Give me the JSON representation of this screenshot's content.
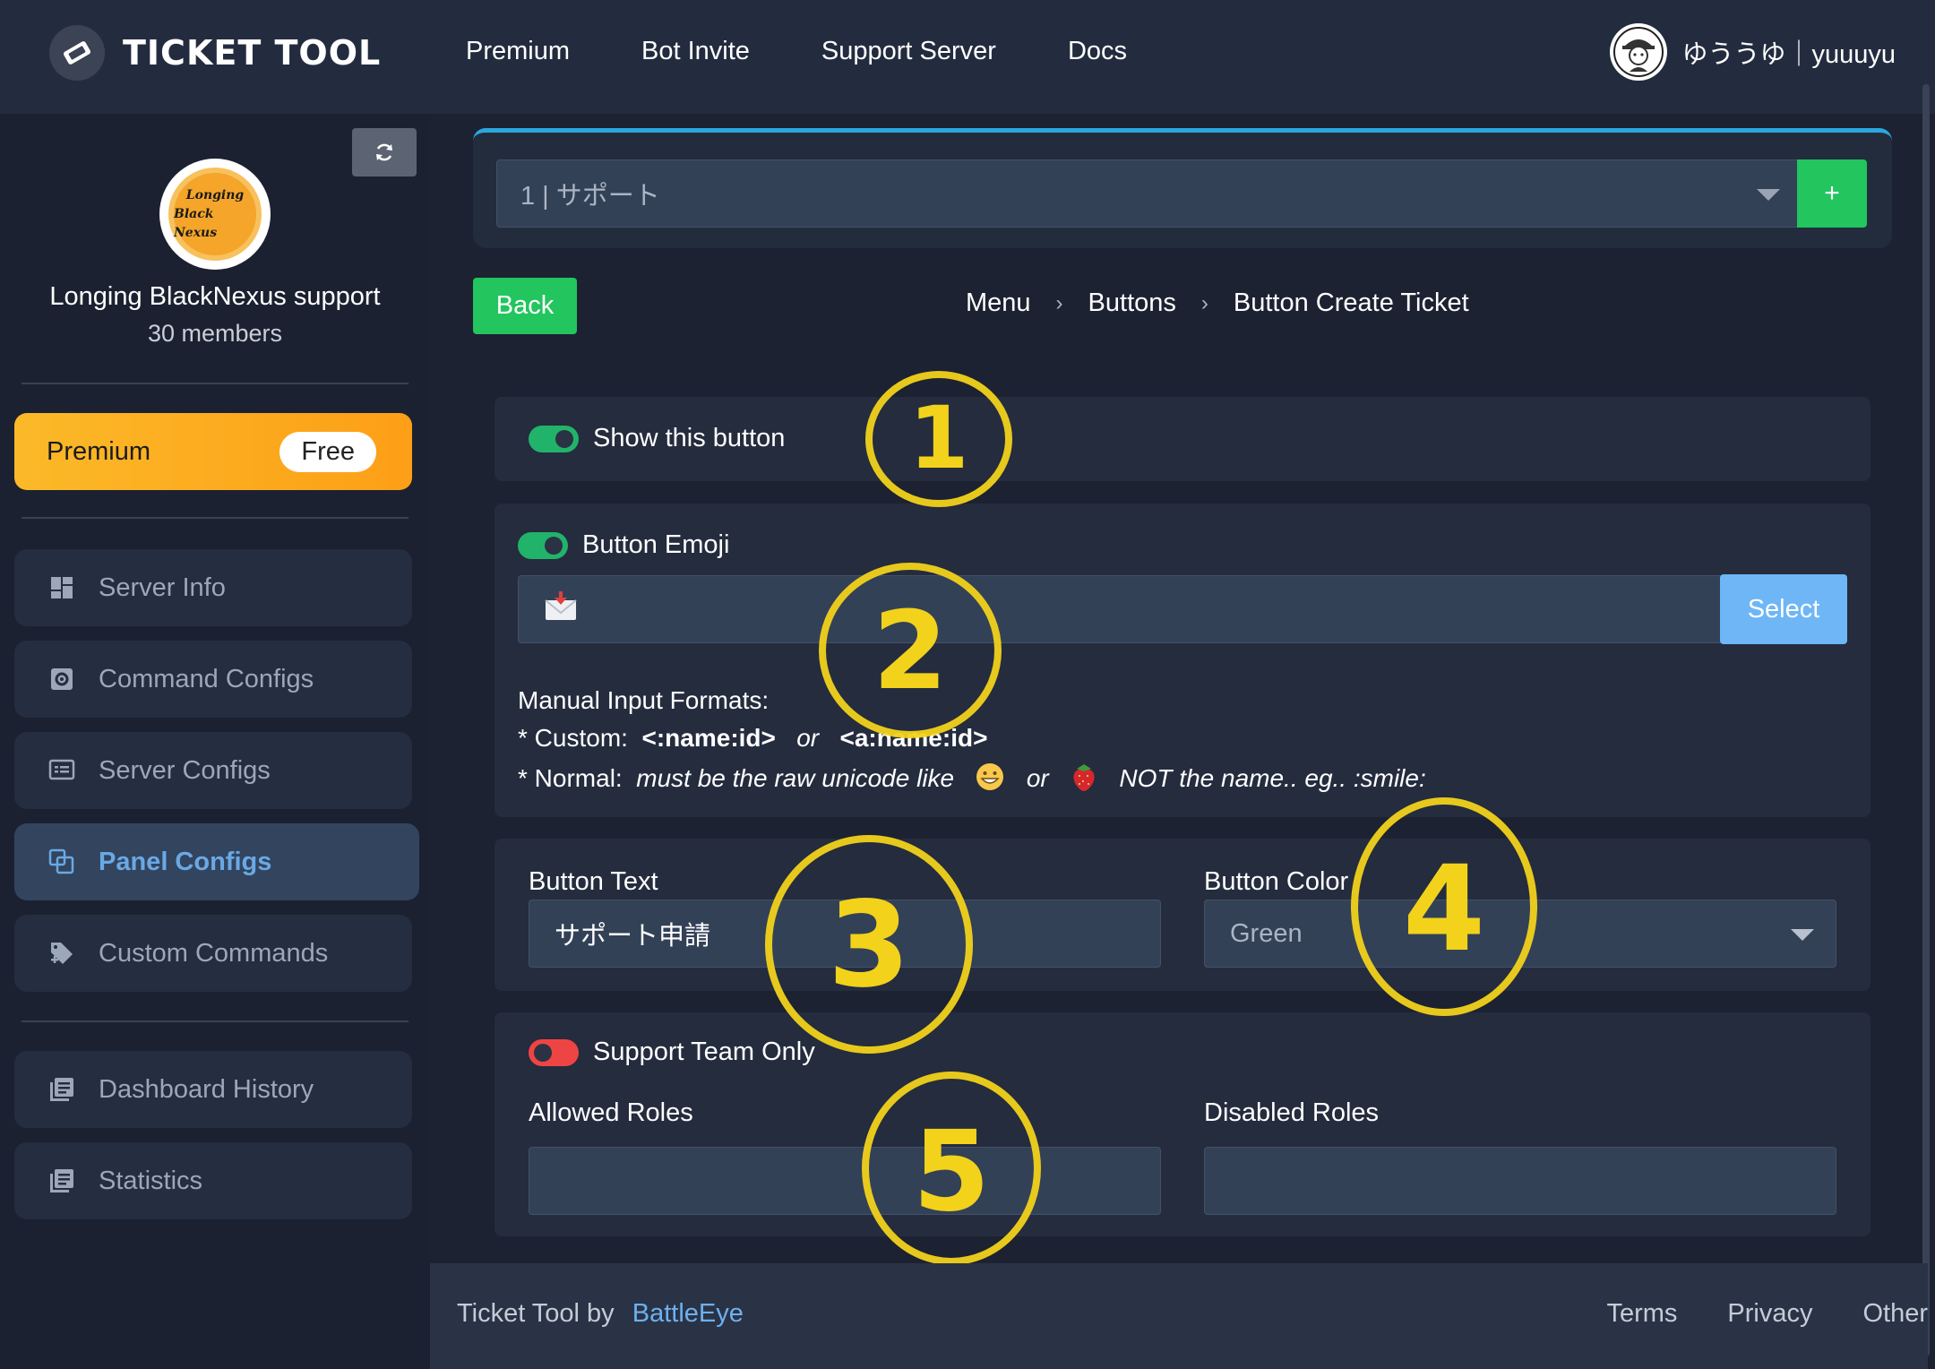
{
  "app": {
    "logo_text": "TICKET TOOL"
  },
  "topnav": {
    "items": [
      "Premium",
      "Bot Invite",
      "Support Server",
      "Docs"
    ]
  },
  "user": {
    "name": "ゆううゆ｜yuuuyu"
  },
  "sidebar": {
    "server_logo_line1": "Longing",
    "server_logo_line2": "Black Nexus",
    "server_name": "Longing BlackNexus support",
    "members": "30 members",
    "premium_label": "Premium",
    "premium_badge": "Free",
    "items": [
      {
        "label": "Server Info",
        "icon": "dashboard-icon"
      },
      {
        "label": "Command Configs",
        "icon": "gear-icon"
      },
      {
        "label": "Server Configs",
        "icon": "server-config-icon"
      },
      {
        "label": "Panel Configs",
        "icon": "panels-icon",
        "active": true
      },
      {
        "label": "Custom Commands",
        "icon": "tag-plus-icon"
      },
      {
        "label": "Dashboard History",
        "icon": "history-icon"
      },
      {
        "label": "Statistics",
        "icon": "statistics-icon"
      }
    ]
  },
  "panel_selector": {
    "value": "1 | サポート",
    "add_label": "+"
  },
  "back_label": "Back",
  "breadcrumb": [
    "Menu",
    "Buttons",
    "Button Create Ticket"
  ],
  "show_button": {
    "label": "Show this button",
    "enabled": true
  },
  "button_emoji": {
    "label": "Button Emoji",
    "enabled": true,
    "value_icon": "incoming-envelope-emoji",
    "select_label": "Select",
    "formats_title": "Manual Input Formats:",
    "custom_prefix": "* Custom:",
    "custom_format_1": "<:name:id>",
    "custom_or": "or",
    "custom_format_2": "<a:name:id>",
    "normal_prefix": "* Normal:",
    "normal_text": "must be the raw unicode like",
    "normal_or": "or",
    "normal_suffix": "NOT the name.. eg.. :smile:"
  },
  "button_text": {
    "label": "Button Text",
    "value": "サポート申請"
  },
  "button_color": {
    "label": "Button Color",
    "value": "Green"
  },
  "support_team": {
    "label": "Support Team Only",
    "enabled": false,
    "allowed_label": "Allowed Roles",
    "disabled_label": "Disabled Roles"
  },
  "annotations": [
    "1",
    "2",
    "3",
    "4",
    "5"
  ],
  "footer": {
    "credit": "Ticket Tool by",
    "credit_link": "BattleEye",
    "links": [
      "Terms",
      "Privacy",
      "Other"
    ]
  },
  "colors": {
    "accent_green": "#22c55e",
    "accent_blue": "#6eb6f6",
    "premium_orange": "#fba61e",
    "annotation_yellow": "#f2d21b"
  }
}
